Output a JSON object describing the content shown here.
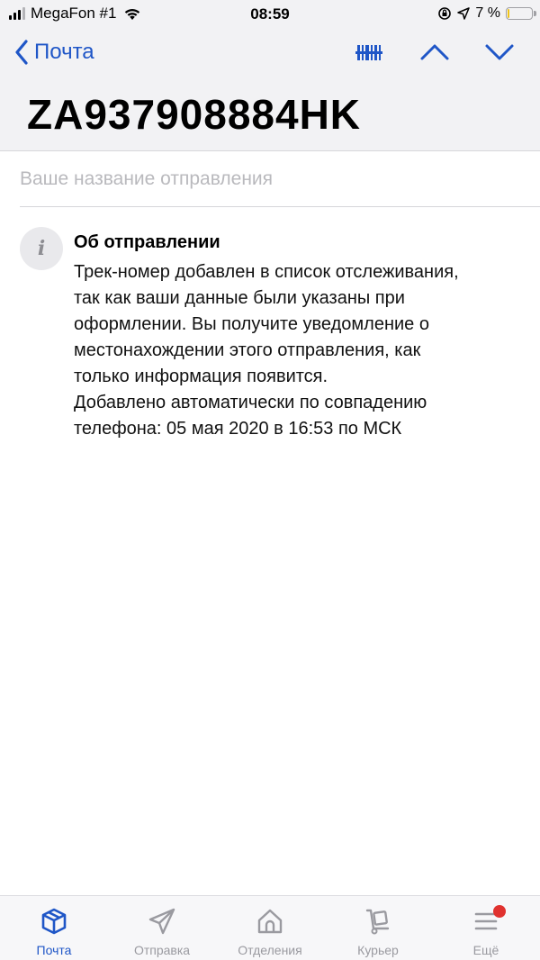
{
  "status_bar": {
    "carrier": "MegaFon #1",
    "time": "08:59",
    "battery_text": "7 %",
    "battery_level": 0.07,
    "battery_color": "#f0c419"
  },
  "header": {
    "back_label": "Почта",
    "tracking_number": "ZA937908884HK",
    "icons": [
      "barcode-icon",
      "chevron-up-icon",
      "chevron-down-icon"
    ]
  },
  "name_field": {
    "value": "",
    "placeholder": "Ваше название отправления"
  },
  "info": {
    "icon": "info-icon",
    "title": "Об отправлении",
    "lines": [
      "Трек-номер добавлен в список отслеживания,",
      "так как ваши данные были указаны при",
      "оформлении. Вы получите уведомление о",
      "местонахождении этого отправления, как",
      "только информация появится.",
      "Добавлено автоматически по совпадению",
      "телефона: 05 мая 2020 в 16:53 по МСК"
    ]
  },
  "tabbar": {
    "accent": "#1f56c7",
    "inactive": "#9a9aa0",
    "badge_color": "#e0322f",
    "tabs": [
      {
        "label": "Почта",
        "icon": "parcel-box-icon",
        "active": true
      },
      {
        "label": "Отправка",
        "icon": "paper-plane-icon",
        "active": false
      },
      {
        "label": "Отделения",
        "icon": "home-office-icon",
        "active": false
      },
      {
        "label": "Курьер",
        "icon": "hand-truck-icon",
        "active": false
      },
      {
        "label": "Ещё",
        "icon": "menu-icon",
        "active": false,
        "badge": true
      }
    ]
  }
}
